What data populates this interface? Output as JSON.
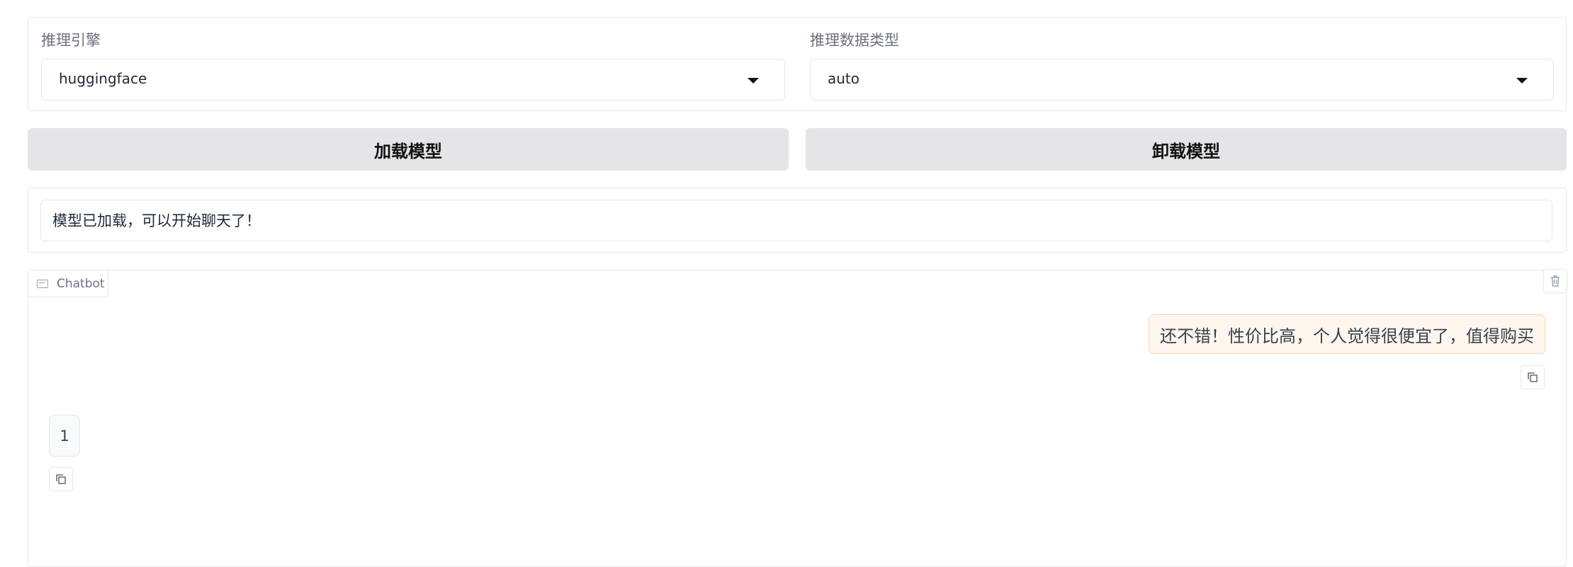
{
  "settings": {
    "engine": {
      "label": "推理引擎",
      "value": "huggingface"
    },
    "dtype": {
      "label": "推理数据类型",
      "value": "auto"
    }
  },
  "actions": {
    "load_label": "加载模型",
    "unload_label": "卸载模型"
  },
  "status": {
    "text": "模型已加载，可以开始聊天了！"
  },
  "chatbot": {
    "label": "Chatbot",
    "label_icon": "chat-icon",
    "clear_icon": "trash-icon",
    "messages": [
      {
        "role": "user",
        "text": "还不错！性价比高，个人觉得很便宜了，值得购买"
      },
      {
        "role": "bot",
        "text": "1"
      }
    ]
  },
  "colors": {
    "button_bg": "#e5e5e7",
    "user_bubble_bg": "#fff7ed",
    "user_bubble_border": "#fbd5a8",
    "border": "#e5e7eb"
  }
}
